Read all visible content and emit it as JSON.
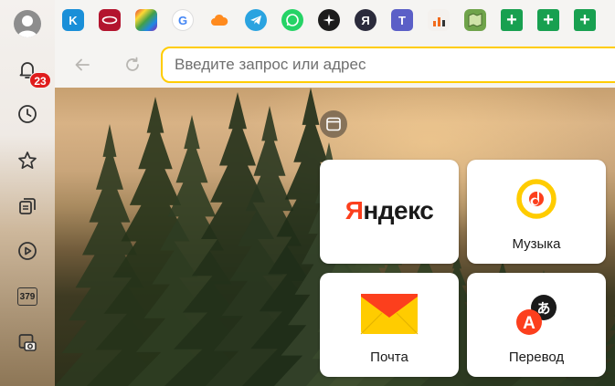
{
  "sidebar": {
    "avatar_icon": "user-avatar-icon",
    "notifications_badge": "23",
    "history_icon": "clock-icon",
    "bookmarks_icon": "star-icon",
    "tabs_icon": "collections-icon",
    "video_icon": "play-icon",
    "tabs_counter": "379",
    "screenshot_icon": "camera-icon"
  },
  "bookmarks": [
    {
      "icon": "kinopoisk-icon",
      "glyph": "K",
      "color": "#1a8fd8"
    },
    {
      "icon": "red-oval-icon",
      "glyph": "",
      "color": "#b3142e"
    },
    {
      "icon": "mosaic-icon",
      "glyph": "",
      "color": "#7a3cbf"
    },
    {
      "icon": "google-icon",
      "glyph": "G",
      "color": "#ffffff"
    },
    {
      "icon": "cloud-icon",
      "glyph": "",
      "color": "#ff8a1e"
    },
    {
      "icon": "telegram-icon",
      "glyph": "",
      "color": "#2aa3e0"
    },
    {
      "icon": "whatsapp-icon",
      "glyph": "",
      "color": "#25d366"
    },
    {
      "icon": "compass-star-icon",
      "glyph": "",
      "color": "#1c1c1c"
    },
    {
      "icon": "yandex-icon",
      "glyph": "Я",
      "color": "#2b2b3c"
    },
    {
      "icon": "teams-icon",
      "glyph": "T",
      "color": "#5b5fc7"
    },
    {
      "icon": "chart-icon",
      "glyph": "",
      "color": "#f4f1ee"
    },
    {
      "icon": "map-icon",
      "glyph": "",
      "color": "#6fa34a"
    },
    {
      "icon": "sheets-plus-icon",
      "glyph": "+",
      "color": "#18a050"
    },
    {
      "icon": "sheets-plus-icon",
      "glyph": "+",
      "color": "#18a050"
    },
    {
      "icon": "sheets-plus-icon",
      "glyph": "+",
      "color": "#18a050"
    }
  ],
  "toolbar": {
    "back_icon": "arrow-left-icon",
    "reload_icon": "reload-icon",
    "address_placeholder": "Введите запрос или адрес"
  },
  "gallery_icon": "window-icon",
  "tiles": [
    {
      "name": "yandex",
      "label": "",
      "logo_text_first": "Я",
      "logo_text_rest": "ндекс"
    },
    {
      "name": "music",
      "label": "Музыка"
    },
    {
      "name": "mail",
      "label": "Почта"
    },
    {
      "name": "translate",
      "label": "Перевод"
    }
  ],
  "colors": {
    "accent_yellow": "#ffcc00",
    "yandex_red": "#fc3f1d",
    "badge_red": "#e01c1c"
  }
}
